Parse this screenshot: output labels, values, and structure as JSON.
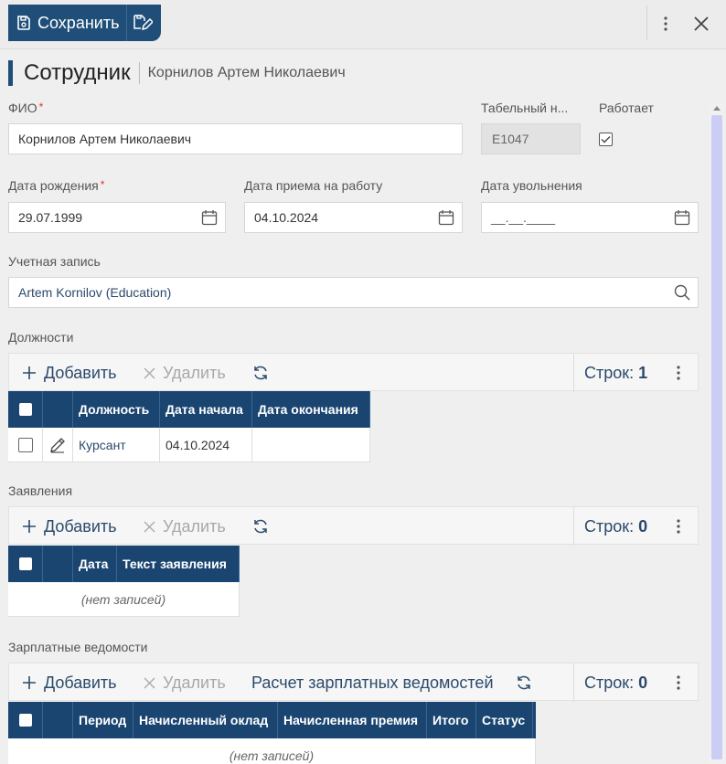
{
  "toolbar": {
    "save_label": "Сохранить"
  },
  "header": {
    "title": "Сотрудник",
    "subtitle": "Корнилов Артем Николаевич"
  },
  "form": {
    "fio": {
      "label": "ФИО",
      "required": "*",
      "value": "Корнилов Артем Николаевич"
    },
    "tabnum": {
      "label": "Табельный н...",
      "value": "E1047"
    },
    "works": {
      "label": "Работает",
      "checked": true
    },
    "birth": {
      "label": "Дата рождения",
      "required": "*",
      "value": "29.07.1999"
    },
    "hire": {
      "label": "Дата приема на работу",
      "value": "04.10.2024"
    },
    "fire": {
      "label": "Дата увольнения",
      "value": "__.__.____"
    },
    "account": {
      "label": "Учетная запись",
      "value": "Artem Kornilov (Education)"
    }
  },
  "positions": {
    "title": "Должности",
    "add_label": "Добавить",
    "delete_label": "Удалить",
    "rows_label": "Строк:",
    "rows_count": "1",
    "columns": [
      "Должность",
      "Дата начала",
      "Дата окончания"
    ],
    "rows": [
      {
        "position": "Курсант",
        "start": "04.10.2024",
        "end": ""
      }
    ]
  },
  "statements": {
    "title": "Заявления",
    "add_label": "Добавить",
    "delete_label": "Удалить",
    "rows_label": "Строк:",
    "rows_count": "0",
    "columns": [
      "Дата",
      "Текст заявления"
    ],
    "empty": "(нет записей)"
  },
  "payroll": {
    "title": "Зарплатные ведомости",
    "add_label": "Добавить",
    "delete_label": "Удалить",
    "calc_label": "Расчет зарплатных ведомостей",
    "rows_label": "Строк:",
    "rows_count": "0",
    "columns": [
      "Период",
      "Начисленный оклад",
      "Начисленная премия",
      "Итого",
      "Статус"
    ],
    "empty": "(нет записей)"
  },
  "colors": {
    "accent": "#1f4e79",
    "grid_header": "#1a4571",
    "scroll_thumb": "#cccdf6"
  }
}
